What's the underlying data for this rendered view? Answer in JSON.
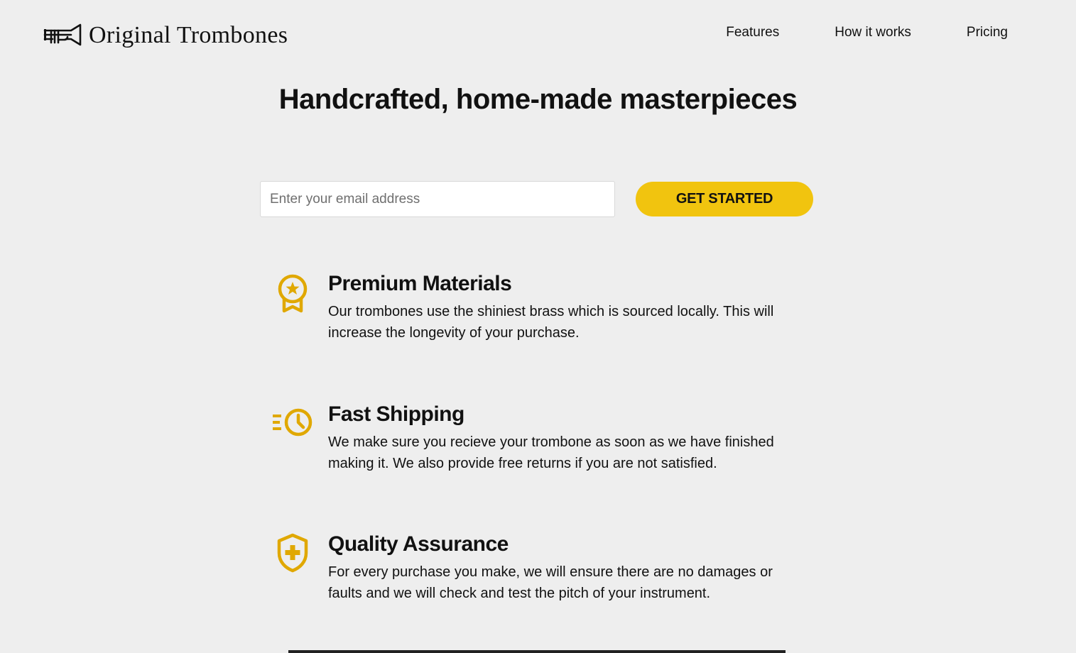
{
  "brand": {
    "name": "Original Trombones",
    "logo_icon": "trombone-icon"
  },
  "nav": {
    "items": [
      {
        "label": "Features"
      },
      {
        "label": "How it works"
      },
      {
        "label": "Pricing"
      }
    ]
  },
  "hero": {
    "title": "Handcrafted, home-made masterpieces"
  },
  "signup": {
    "email_placeholder": "Enter your email address",
    "email_value": "",
    "button_label": "GET STARTED"
  },
  "features": [
    {
      "icon": "award-medal-icon",
      "title": "Premium Materials",
      "text": "Our trombones use the shiniest brass which is sourced locally. This will increase the longevity of your purchase."
    },
    {
      "icon": "fast-shipping-clock-icon",
      "title": "Fast Shipping",
      "text": "We make sure you recieve your trombone as soon as we have finished making it. We also provide free returns if you are not satisfied."
    },
    {
      "icon": "shield-plus-icon",
      "title": "Quality Assurance",
      "text": "For every purchase you make, we will ensure there are no damages or faults and we will check and test the pitch of your instrument."
    }
  ],
  "colors": {
    "background": "#eeeeee",
    "accent": "#f1c40f",
    "icon_gold": "#e0a800",
    "text": "#111111"
  }
}
